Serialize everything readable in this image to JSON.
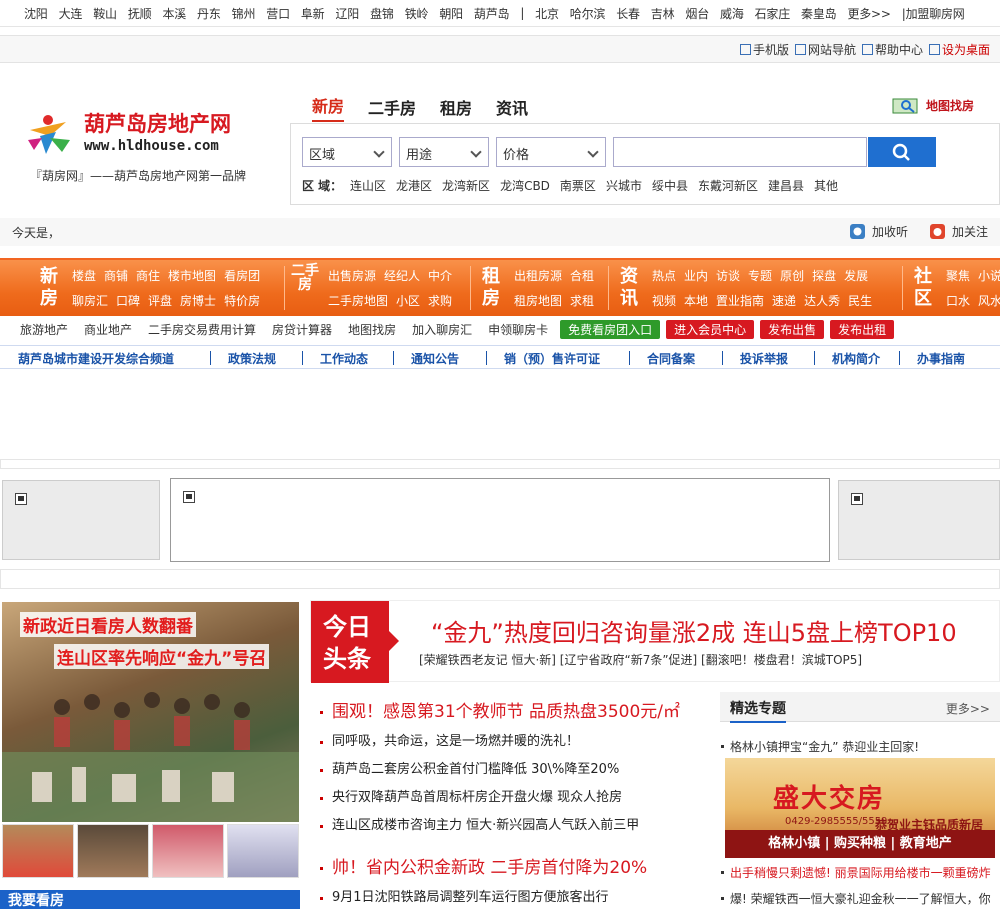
{
  "city_bar": {
    "cities": [
      "沈阳",
      "大连",
      "鞍山",
      "抚顺",
      "本溪",
      "丹东",
      "锦州",
      "营口",
      "阜新",
      "辽阳",
      "盘锦",
      "铁岭",
      "朝阳",
      "葫芦岛",
      "|",
      "北京",
      "哈尔滨",
      "长春",
      "吉林",
      "烟台",
      "威海",
      "石家庄",
      "秦皇岛",
      "更多>>",
      "|加盟聊房网"
    ]
  },
  "top_bar": {
    "mobile": "手机版",
    "site_nav": "网站导航",
    "help": "帮助中心",
    "set_home": "设为桌面"
  },
  "logo": {
    "name": "葫芦岛房地产网",
    "url_text": "www.hldhouse.com",
    "slogan": "『葫房网』——葫芦岛房地产网第一品牌"
  },
  "search": {
    "tabs": [
      "新房",
      "二手房",
      "租房",
      "资讯"
    ],
    "active_tab": 0,
    "map_search": "地图找房",
    "selects": [
      "区域",
      "用途",
      "价格"
    ],
    "area_label": "区 域：",
    "areas": [
      "连山区",
      "龙港区",
      "龙湾新区",
      "龙湾CBD",
      "南票区",
      "兴城市",
      "绥中县",
      "东戴河新区",
      "建昌县",
      "其他"
    ]
  },
  "date_bar": {
    "today": "今天是，",
    "listen": "加收听",
    "follow": "加关注"
  },
  "main_nav": {
    "blocks": [
      {
        "title": "新房",
        "row1": [
          "楼盘",
          "商铺",
          "商住",
          "楼市地图",
          "看房团"
        ],
        "row2": [
          "聊房汇",
          "口碑",
          "评盘",
          "房博士",
          "特价房"
        ]
      },
      {
        "title": "二手房",
        "row1": [
          "出售房源",
          "经纪人",
          "中介"
        ],
        "row2": [
          "二手房地图",
          "小区",
          "求购"
        ]
      },
      {
        "title": "租房",
        "row1": [
          "出租房源",
          "合租"
        ],
        "row2": [
          "租房地图",
          "求租"
        ]
      },
      {
        "title": "资讯",
        "row1": [
          "热点",
          "业内",
          "访谈",
          "专题",
          "原创",
          "探盘",
          "发展"
        ],
        "row2": [
          "视频",
          "本地",
          "置业指南",
          "速递",
          "达人秀",
          "民生"
        ]
      },
      {
        "title": "社区",
        "row1": [
          "聚焦",
          "小说"
        ],
        "row2": [
          "口水",
          "风水"
        ]
      }
    ]
  },
  "sub_nav": {
    "links": [
      "旅游地产",
      "商业地产",
      "二手房交易费用计算",
      "房贷计算器",
      "地图找房",
      "加入聊房汇",
      "申领聊房卡"
    ],
    "buttons": [
      {
        "label": "免费看房团入口",
        "color": "#2e9a2a"
      },
      {
        "label": "进入会员中心",
        "color": "#d71920"
      },
      {
        "label": "发布出售",
        "color": "#d71920"
      },
      {
        "label": "发布出租",
        "color": "#d71920"
      }
    ]
  },
  "channel_bar": {
    "items": [
      "葫芦岛城市建设开发综合频道",
      "政策法规",
      "工作动态",
      "通知公告",
      "销（预）售许可证",
      "合同备案",
      "投诉举报",
      "机构简介",
      "办事指南"
    ]
  },
  "feature": {
    "photo_line1": "新政近日看房人数翻番",
    "photo_line2": "连山区率先响应“金九”号召",
    "bottom_left": "我要看房"
  },
  "headline": {
    "badge_line1": "今日",
    "badge_line2": "头条",
    "title": "“金九”热度回归咨询量涨2成 连山5盘上榜TOP10",
    "sub": "[荣耀铁西老友记 恒大·新] [辽宁省政府“新7条”促进] [翻滚吧！楼盘君！滨城TOP5]"
  },
  "news": {
    "items": [
      {
        "text": "围观！感恩第31个教师节 品质热盘3500元/㎡",
        "hot": true
      },
      {
        "text": "同呼吸，共命运，这是一场燃并暖的洗礼！",
        "hot": false
      },
      {
        "text": "葫芦岛二套房公积金首付门槛降低 30\\%降至20%",
        "hot": false
      },
      {
        "text": "央行双降葫芦岛首周标杆房企开盘火爆 现众人抢房",
        "hot": false
      },
      {
        "text": "连山区成楼市咨询主力 恒大·新兴园高人气跃入前三甲",
        "hot": false
      },
      {
        "text": "帅！省内公积金新政 二手房首付降为20%",
        "hot": true
      },
      {
        "text": "9月1日沈阳铁路局调整列车运行图方便旅客出行",
        "hot": false
      }
    ]
  },
  "topics": {
    "title": "精选专题",
    "more": "更多>>",
    "first": "格林小镇押宝“金九” 恭迎业主回家!",
    "banner_title": "盛大交房",
    "banner_phone": "0429-2985555/5559",
    "banner_sub": "恭贺业主钰品质新居",
    "banner_band": "格林小镇 | 购买种粮 | 教育地产",
    "line2": "出手稍慢只剩遗憾! 丽景国际用给楼市一颗重磅炸",
    "line3": "爆! 荣耀铁西一恒大豪礼迎金秋一一了解恒大，你"
  }
}
